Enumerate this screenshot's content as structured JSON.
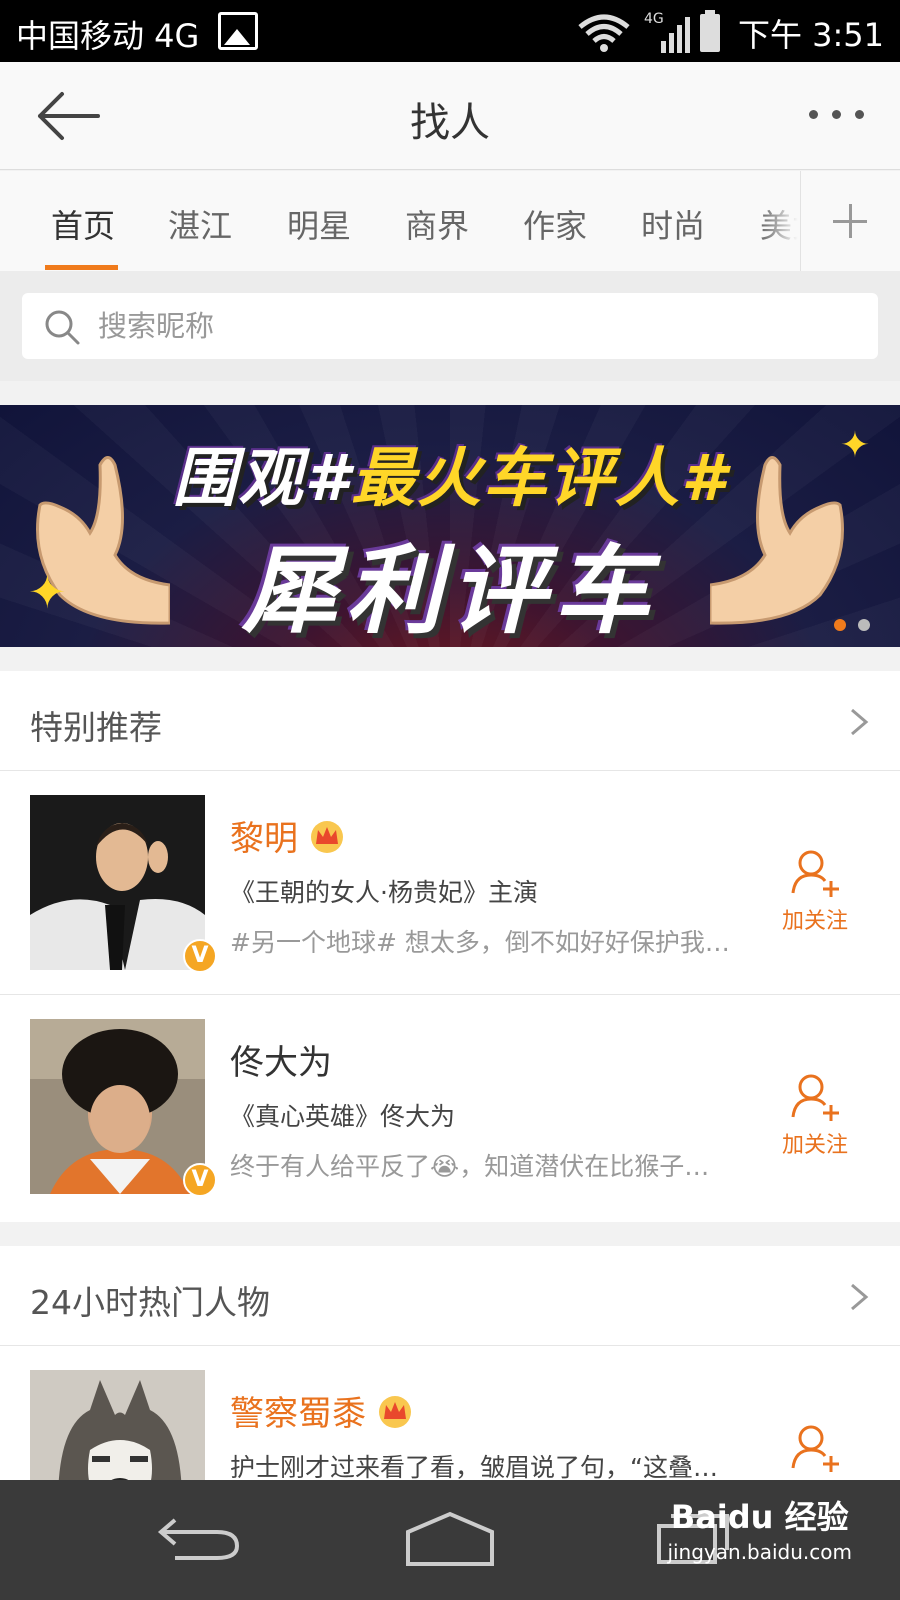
{
  "status_bar": {
    "carrier": "中国移动 4G",
    "network": "4G",
    "time": "下午 3:51"
  },
  "header": {
    "title": "找人"
  },
  "tabs": [
    "首页",
    "湛江",
    "明星",
    "商界",
    "作家",
    "时尚",
    "美女"
  ],
  "search": {
    "placeholder": "搜索昵称"
  },
  "banner": {
    "line1_pre": "围观#",
    "line1_hl": "最火车评人#",
    "line2": "犀利评车"
  },
  "section_recommend": {
    "title": "特别推荐",
    "items": [
      {
        "name": "黎明",
        "desc": "《王朝的女人·杨贵妃》主演",
        "status": "#另一个地球# 想太多，倒不如好好保护我…",
        "follow": "加关注",
        "verified": "V"
      },
      {
        "name": "佟大为",
        "desc": "《真心英雄》佟大为",
        "status": "终于有人给平反了😭，知道潜伏在比猴子…",
        "follow": "加关注",
        "verified": "V"
      }
    ]
  },
  "section_hot": {
    "title": "24小时热门人物",
    "items": [
      {
        "name": "警察蜀黍",
        "status": "护士刚才过来看了看，皱眉说了句，“这叠…",
        "follow": "加关注"
      }
    ]
  },
  "watermark": {
    "logo": "Baidu 经验",
    "url": "jingyan.baidu.com"
  },
  "colors": {
    "accent": "#e9721e",
    "underline": "#f07b1c"
  }
}
